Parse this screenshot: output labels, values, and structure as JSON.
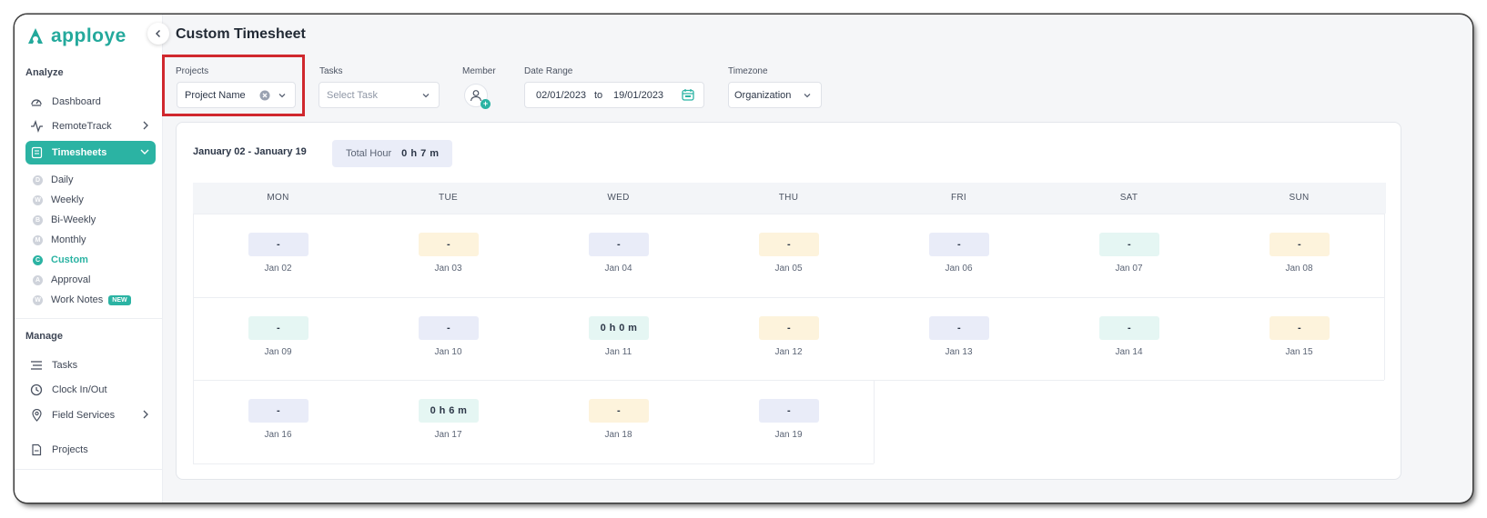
{
  "app": {
    "logo_text": "apploye",
    "accent_color": "#2bb3a3"
  },
  "sidebar": {
    "sections": {
      "analyze": "Analyze",
      "manage": "Manage"
    },
    "analyze_items": [
      {
        "label": "Dashboard",
        "icon": "dashboard-gauge-icon"
      },
      {
        "label": "RemoteTrack",
        "icon": "activity-pulse-icon"
      },
      {
        "label": "Timesheets",
        "icon": "timesheet-icon",
        "active": true
      }
    ],
    "timesheet_sub_items": [
      {
        "letter": "D",
        "label": "Daily"
      },
      {
        "letter": "W",
        "label": "Weekly"
      },
      {
        "letter": "B",
        "label": "Bi-Weekly"
      },
      {
        "letter": "M",
        "label": "Monthly"
      },
      {
        "letter": "C",
        "label": "Custom",
        "active": true
      },
      {
        "letter": "A",
        "label": "Approval"
      },
      {
        "letter": "W",
        "label": "Work Notes",
        "badge": "NEW"
      }
    ],
    "manage_items": [
      {
        "label": "Tasks",
        "icon": "list-icon"
      },
      {
        "label": "Clock In/Out",
        "icon": "clock-icon"
      },
      {
        "label": "Field Services",
        "icon": "location-pin-icon"
      },
      {
        "label": "Projects",
        "icon": "document-icon"
      }
    ]
  },
  "page": {
    "title": "Custom Timesheet"
  },
  "filters": {
    "projects": {
      "label": "Projects",
      "value": "Project Name"
    },
    "tasks": {
      "label": "Tasks",
      "placeholder": "Select Task"
    },
    "member": {
      "label": "Member"
    },
    "date_range": {
      "label": "Date Range",
      "start": "02/01/2023",
      "separator": "to",
      "end": "19/01/2023"
    },
    "timezone": {
      "label": "Timezone",
      "value": "Organization"
    }
  },
  "summary": {
    "range_title": "January 02 - January 19",
    "total_label": "Total Hour",
    "total_value": "0 h 7 m"
  },
  "calendar": {
    "weekdays": [
      "MON",
      "TUE",
      "WED",
      "THU",
      "FRI",
      "SAT",
      "SUN"
    ],
    "weeks": [
      [
        {
          "date": "Jan 02",
          "value": "-",
          "tone": "blue"
        },
        {
          "date": "Jan 03",
          "value": "-",
          "tone": "yellow"
        },
        {
          "date": "Jan 04",
          "value": "-",
          "tone": "blue"
        },
        {
          "date": "Jan 05",
          "value": "-",
          "tone": "yellow"
        },
        {
          "date": "Jan 06",
          "value": "-",
          "tone": "blue"
        },
        {
          "date": "Jan 07",
          "value": "-",
          "tone": "green"
        },
        {
          "date": "Jan 08",
          "value": "-",
          "tone": "yellow"
        }
      ],
      [
        {
          "date": "Jan 09",
          "value": "-",
          "tone": "green"
        },
        {
          "date": "Jan 10",
          "value": "-",
          "tone": "blue"
        },
        {
          "date": "Jan 11",
          "value": "0 h 0 m",
          "tone": "green"
        },
        {
          "date": "Jan 12",
          "value": "-",
          "tone": "yellow"
        },
        {
          "date": "Jan 13",
          "value": "-",
          "tone": "blue"
        },
        {
          "date": "Jan 14",
          "value": "-",
          "tone": "green"
        },
        {
          "date": "Jan 15",
          "value": "-",
          "tone": "yellow"
        }
      ],
      [
        {
          "date": "Jan 16",
          "value": "-",
          "tone": "blue"
        },
        {
          "date": "Jan 17",
          "value": "0 h 6 m",
          "tone": "green"
        },
        {
          "date": "Jan 18",
          "value": "-",
          "tone": "yellow"
        },
        {
          "date": "Jan 19",
          "value": "-",
          "tone": "blue"
        }
      ]
    ]
  }
}
